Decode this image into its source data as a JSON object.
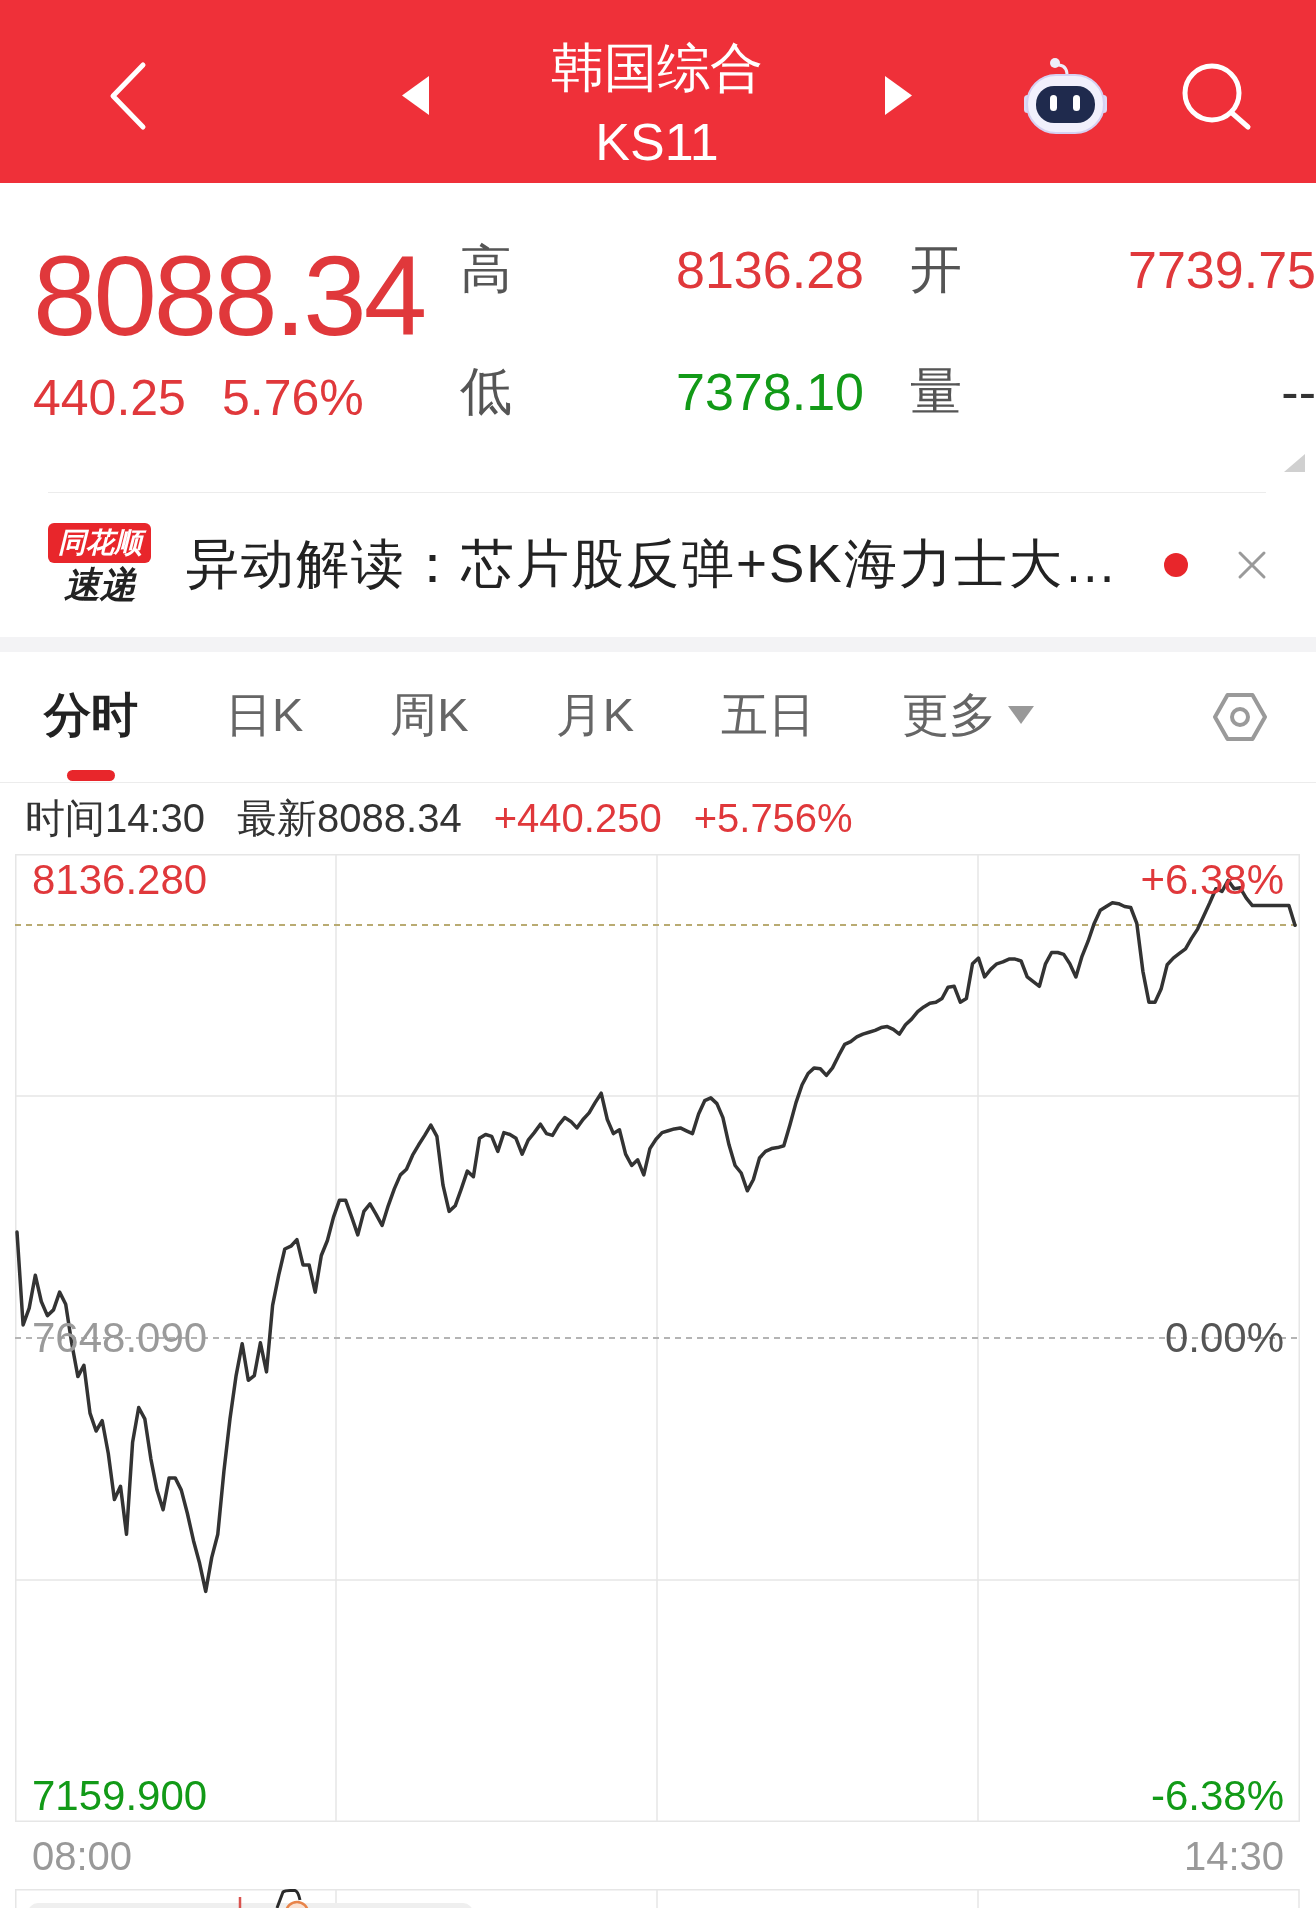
{
  "header": {
    "title": "韩国综合",
    "code": "KS11"
  },
  "quote": {
    "price": "8088.34",
    "change": "440.25",
    "change_pct": "5.76%",
    "color": "#e0383b",
    "stats": [
      {
        "label": "高",
        "value": "8136.28",
        "color": "#e0383b"
      },
      {
        "label": "开",
        "value": "7739.75",
        "color": "#e0383b"
      },
      {
        "label": "低",
        "value": "7378.10",
        "color": "#129a17"
      },
      {
        "label": "量",
        "value": "--",
        "color": "#333333"
      }
    ]
  },
  "news": {
    "logo_top": "同花顺",
    "logo_bottom": "速递",
    "text": "异动解读：芯片股反弹+SK海力士大…",
    "unread": true
  },
  "tabs": [
    {
      "label": "分时",
      "selected": true,
      "kind": "tab"
    },
    {
      "label": "日K",
      "selected": false,
      "kind": "tab"
    },
    {
      "label": "周K",
      "selected": false,
      "kind": "tab"
    },
    {
      "label": "月K",
      "selected": false,
      "kind": "tab"
    },
    {
      "label": "五日",
      "selected": false,
      "kind": "tab"
    },
    {
      "label": "更多",
      "selected": false,
      "kind": "menu"
    }
  ],
  "quote_line": [
    {
      "text": "时间14:30",
      "color": "#333333"
    },
    {
      "text": "最新8088.34",
      "color": "#333333"
    },
    {
      "text": "+440.250",
      "color": "#e0383b"
    },
    {
      "text": "+5.756%",
      "color": "#e0383b"
    }
  ],
  "chart": {
    "right_labels": [
      {
        "text": "+6.38%",
        "color": "#e0383b"
      },
      {
        "text": "0.00%",
        "color": "#555555"
      },
      {
        "text": "-6.38%",
        "color": "#129a17"
      }
    ],
    "time_labels": [
      "08:00",
      "14:30"
    ],
    "chart_data": {
      "type": "line",
      "ylim": [
        7132.2,
        8164
      ],
      "yticks": [
        {
          "value": 8136.28,
          "label": "8136.280"
        },
        {
          "value": 7648.09,
          "label": "7648.090"
        },
        {
          "value": 7159.9,
          "label": "7159.900"
        }
      ],
      "ref_lines": [
        {
          "axis": "y",
          "value": 7648.09,
          "color": "#b4b4b4"
        },
        {
          "axis": "y",
          "value": 8088.34,
          "color": "#b9ab72"
        }
      ],
      "series": [
        {
          "color": "#333333",
          "values": [
            7761,
            7662,
            7680,
            7715,
            7687,
            7672,
            7678,
            7697,
            7684,
            7642,
            7607,
            7619,
            7568,
            7549,
            7560,
            7525,
            7476,
            7490,
            7439,
            7537,
            7574,
            7562,
            7519,
            7486,
            7465,
            7499,
            7499,
            7486,
            7461,
            7432,
            7408,
            7378,
            7414,
            7439,
            7506,
            7562,
            7608,
            7642,
            7603,
            7608,
            7643,
            7612,
            7683,
            7715,
            7743,
            7746,
            7753,
            7726,
            7726,
            7697,
            7736,
            7752,
            7777,
            7795,
            7795,
            7777,
            7758,
            7783,
            7791,
            7780,
            7768,
            7789,
            7807,
            7822,
            7828,
            7843,
            7854,
            7864,
            7875,
            7863,
            7811,
            7783,
            7789,
            7807,
            7826,
            7820,
            7861,
            7865,
            7863,
            7847,
            7867,
            7865,
            7861,
            7844,
            7859,
            7867,
            7876,
            7866,
            7864,
            7875,
            7883,
            7879,
            7872,
            7881,
            7888,
            7899,
            7909,
            7881,
            7866,
            7870,
            7844,
            7832,
            7838,
            7822,
            7850,
            7860,
            7867,
            7869,
            7871,
            7872,
            7869,
            7866,
            7887,
            7901,
            7904,
            7898,
            7883,
            7854,
            7832,
            7824,
            7805,
            7817,
            7840,
            7847,
            7850,
            7851,
            7853,
            7875,
            7899,
            7918,
            7930,
            7936,
            7935,
            7928,
            7936,
            7949,
            7961,
            7964,
            7969,
            7972,
            7974,
            7976,
            7979,
            7980,
            7977,
            7972,
            7982,
            7988,
            7996,
            8001,
            8005,
            8006,
            8010,
            8022,
            8023,
            8006,
            8010,
            8047,
            8053,
            8033,
            8041,
            8047,
            8049,
            8052,
            8052,
            8050,
            8033,
            8028,
            8023,
            8047,
            8059,
            8059,
            8057,
            8047,
            8033,
            8055,
            8071,
            8090,
            8104,
            8108,
            8112,
            8111,
            8108,
            8107,
            8090,
            8039,
            8006,
            8006,
            8020,
            8046,
            8053,
            8058,
            8063,
            8074,
            8084,
            8098,
            8112,
            8127,
            8124,
            8136,
            8127,
            8128,
            8117,
            8109,
            8109,
            8109,
            8109,
            8109,
            8109,
            8109,
            8088
          ]
        }
      ]
    }
  }
}
